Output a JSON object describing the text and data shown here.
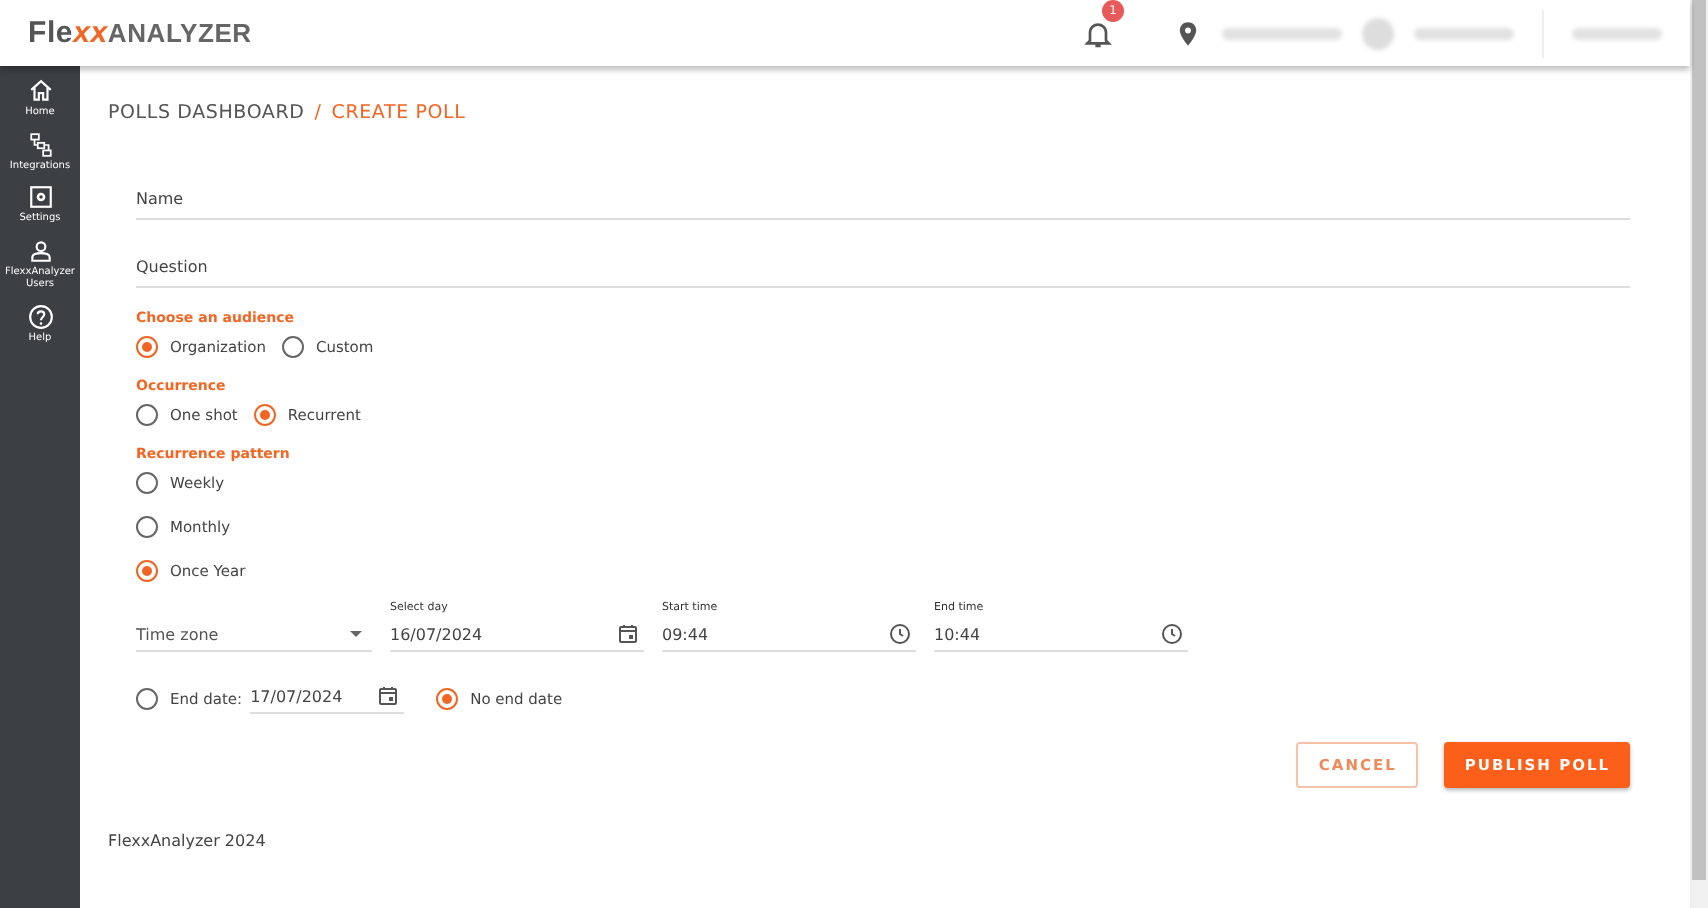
{
  "header": {
    "logo": {
      "start": "Fle",
      "mark": "xx",
      "end": "ANALYZER"
    },
    "notification_badge": "1"
  },
  "sidebar": {
    "items": [
      {
        "kind": "home",
        "label": "Home"
      },
      {
        "kind": "integrations",
        "label": "Integrations"
      },
      {
        "kind": "settings",
        "label": "Settings"
      },
      {
        "kind": "users",
        "label": "FlexxAnalyzer Users"
      },
      {
        "kind": "help",
        "label": "Help"
      }
    ]
  },
  "breadcrumb": [
    {
      "label": "POLLS DASHBOARD",
      "current": false
    },
    {
      "label": "CREATE POLL",
      "current": true
    }
  ],
  "breadcrumb_separator": "/",
  "fields": [
    {
      "placeholder": "Name"
    },
    {
      "placeholder": "Question"
    }
  ],
  "groups": [
    {
      "title": "Choose an audience",
      "kind": "row",
      "options": [
        {
          "label": "Organization",
          "selected": true
        },
        {
          "label": "Custom",
          "selected": false
        }
      ]
    },
    {
      "title": "Occurrence",
      "kind": "row",
      "options": [
        {
          "label": "One shot",
          "selected": false
        },
        {
          "label": "Recurrent",
          "selected": true
        }
      ]
    },
    {
      "title": "Recurrence pattern",
      "kind": "column",
      "options": [
        {
          "label": "Weekly",
          "selected": false
        },
        {
          "label": "Monthly",
          "selected": false
        },
        {
          "label": "Once Year",
          "selected": true
        }
      ]
    }
  ],
  "schedule": [
    {
      "kind": "select",
      "placeholder": "Time zone"
    },
    {
      "kind": "date",
      "label": "Select day",
      "value": "16/07/2024"
    },
    {
      "kind": "time",
      "label": "Start time",
      "value": "09:44"
    },
    {
      "kind": "time",
      "label": "End time",
      "value": "10:44"
    }
  ],
  "end": [
    {
      "kind": "date",
      "label": "End date:",
      "value": "17/07/2024",
      "selected": false
    },
    {
      "kind": "plain",
      "label": "No end date",
      "selected": true
    }
  ],
  "buttons": [
    {
      "kind": "outline",
      "label": "CANCEL"
    },
    {
      "kind": "primary",
      "label": "PUBLISH POLL"
    }
  ],
  "footer": "FlexxAnalyzer 2024"
}
